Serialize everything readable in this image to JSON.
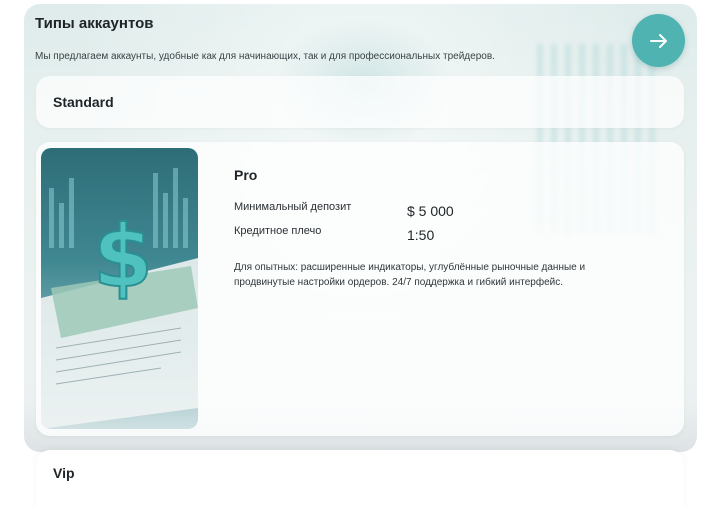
{
  "section": {
    "title": "Типы аккаунтов",
    "subtitle": "Мы предлагаем аккаунты, удобные как для начинающих, так и для профессиональных трейдеров.",
    "next_icon": "arrow-right-icon"
  },
  "accounts": [
    {
      "name": "Standard",
      "expanded": false
    },
    {
      "name": "Pro",
      "expanded": true,
      "min_deposit_label": "Минимальный депозит",
      "min_deposit_value": "$ 5 000",
      "leverage_label": "Кредитное плечо",
      "leverage_value": "1:50",
      "description": "Для опытных: расширенные индикаторы, углублённые рыночные данные и продвинутые настройки ордеров. 24/7 поддержка и гибкий интерфейс.",
      "image_icon": "dollar-sign-icon"
    },
    {
      "name": "Vip",
      "expanded": false
    }
  ],
  "colors": {
    "accent": "#4fb3b2",
    "text": "#1e2427"
  }
}
